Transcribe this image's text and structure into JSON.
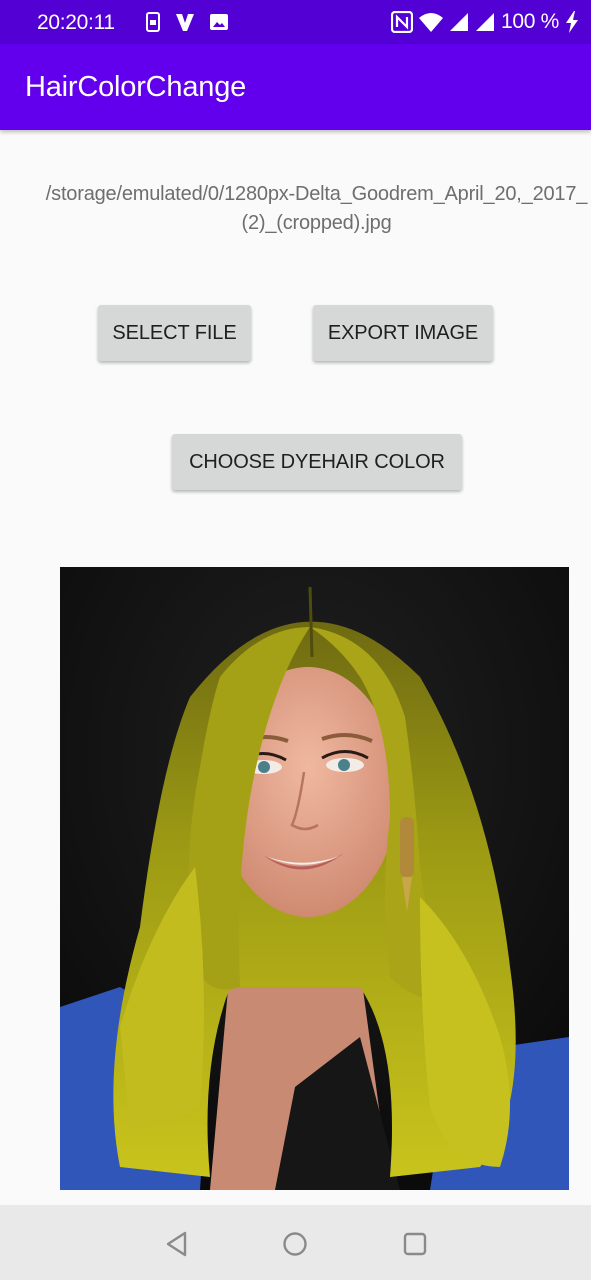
{
  "status_bar": {
    "time": "20:20:11",
    "battery": "100 %",
    "icons": [
      "sim-card-icon",
      "vpn-v-icon",
      "image-icon",
      "nfc-icon",
      "wifi-icon",
      "signal-icon",
      "signal-icon",
      "charging-bolt-icon"
    ]
  },
  "app_bar": {
    "title": "HairColorChange",
    "color": "#6200ee"
  },
  "main": {
    "file_path": "/storage/emulated/0/1280px-Delta_Goodrem_April_20,_2017_(2)_(cropped).jpg",
    "select_file_label": "SELECT FILE",
    "export_image_label": "EXPORT IMAGE",
    "choose_color_label": "CHOOSE DYEHAIR COLOR",
    "image_icon": "portrait-photo"
  },
  "nav_bar": {
    "icons": [
      "back-triangle-icon",
      "home-circle-icon",
      "recents-square-icon"
    ]
  }
}
